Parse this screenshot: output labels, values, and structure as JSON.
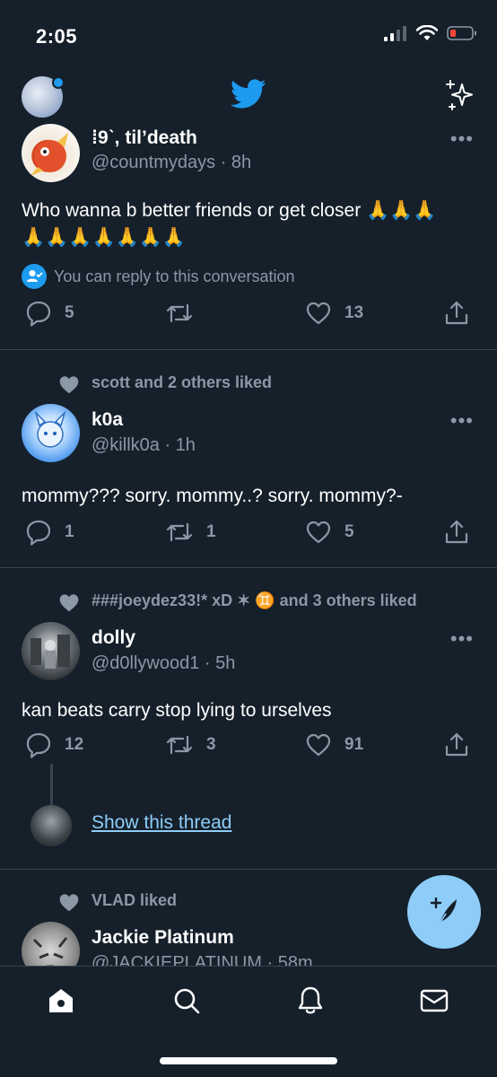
{
  "status_bar": {
    "time": "2:05"
  },
  "header": {
    "logo": "twitter-bird-icon",
    "sparkle": "sparkle-icon"
  },
  "tweets": [
    {
      "name": "⁞9ˋ, til’death",
      "handle": "@countmydays",
      "time": "8h",
      "text": "Who wanna b better friends or get closer 🙏🙏🙏\n🙏🙏🙏🙏🙏🙏🙏",
      "reply_note": "You can reply to this conversation",
      "replies": "5",
      "retweets": "",
      "likes": "13"
    },
    {
      "social": "scott and 2 others liked",
      "name": "k0a",
      "handle": "@killk0a",
      "time": "1h",
      "text": "mommy??? sorry. mommy..? sorry. mommy?-",
      "replies": "1",
      "retweets": "1",
      "likes": "5"
    },
    {
      "social": "###joeydez33!* xD ✶ ♊ and 3 others liked",
      "name": "dolly",
      "handle": "@d0llywood1",
      "time": "5h",
      "text": "kan beats carry stop lying to urselves",
      "replies": "12",
      "retweets": "3",
      "likes": "91",
      "show_thread": "Show this thread"
    },
    {
      "social": "VLAD liked",
      "name": "Jackie Platinum",
      "handle": "@JACKIEPLATINUM",
      "time": "58m"
    }
  ],
  "tabs": [
    "home-icon",
    "search-icon",
    "notifications-bell-icon",
    "messages-envelope-icon"
  ],
  "colors": {
    "background": "#15202b",
    "accent": "#1d9bf0",
    "fab": "#8ecdf8",
    "muted": "#8b98a5"
  }
}
